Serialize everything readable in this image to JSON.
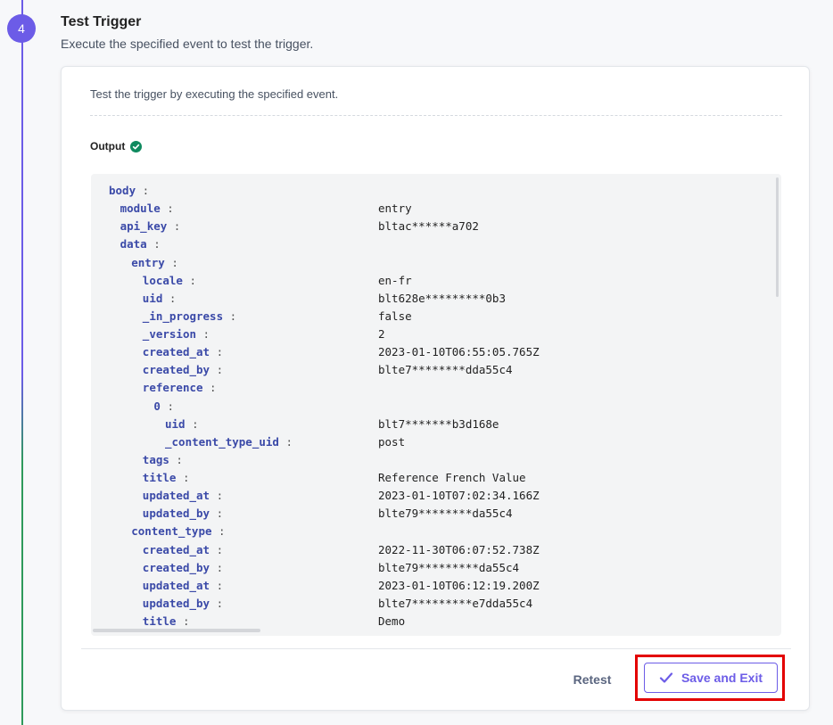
{
  "step": {
    "number": "4",
    "title": "Test Trigger",
    "description": "Execute the specified event to test the trigger."
  },
  "card": {
    "description": "Test the trigger by executing the specified event.",
    "output_label": "Output"
  },
  "output_lines": [
    {
      "key": "body",
      "value": "",
      "indent": 0
    },
    {
      "key": "module",
      "value": "entry",
      "indent": 1
    },
    {
      "key": "api_key",
      "value": "bltac******a702",
      "indent": 1
    },
    {
      "key": "data",
      "value": "",
      "indent": 1
    },
    {
      "key": "entry",
      "value": "",
      "indent": 2
    },
    {
      "key": "locale",
      "value": "en-fr",
      "indent": 3
    },
    {
      "key": "uid",
      "value": "blt628e*********0b3",
      "indent": 3
    },
    {
      "key": "_in_progress",
      "value": "false",
      "indent": 3
    },
    {
      "key": "_version",
      "value": "2",
      "indent": 3
    },
    {
      "key": "created_at",
      "value": "2023-01-10T06:55:05.765Z",
      "indent": 3
    },
    {
      "key": "created_by",
      "value": "blte7********dda55c4",
      "indent": 3
    },
    {
      "key": "reference",
      "value": "",
      "indent": 3
    },
    {
      "key": "0",
      "value": "",
      "indent": 4
    },
    {
      "key": "uid",
      "value": "blt7*******b3d168e",
      "indent": 5
    },
    {
      "key": "_content_type_uid",
      "value": "post",
      "indent": 5
    },
    {
      "key": "tags",
      "value": "",
      "indent": 3
    },
    {
      "key": "title",
      "value": "Reference French Value",
      "indent": 3
    },
    {
      "key": "updated_at",
      "value": "2023-01-10T07:02:34.166Z",
      "indent": 3
    },
    {
      "key": "updated_by",
      "value": "blte79********da55c4",
      "indent": 3
    },
    {
      "key": "content_type",
      "value": "",
      "indent": 2
    },
    {
      "key": "created_at",
      "value": "2022-11-30T06:07:52.738Z",
      "indent": 3
    },
    {
      "key": "created_by",
      "value": "blte79*********da55c4",
      "indent": 3
    },
    {
      "key": "updated_at",
      "value": "2023-01-10T06:12:19.200Z",
      "indent": 3
    },
    {
      "key": "updated_by",
      "value": "blte7*********e7dda55c4",
      "indent": 3
    },
    {
      "key": "title",
      "value": "Demo",
      "indent": 3
    }
  ],
  "footer": {
    "retest_label": "Retest",
    "save_label": "Save and Exit"
  },
  "colors": {
    "accent": "#6c5ce7",
    "success": "#0f8a5f",
    "highlight": "#e30000"
  }
}
